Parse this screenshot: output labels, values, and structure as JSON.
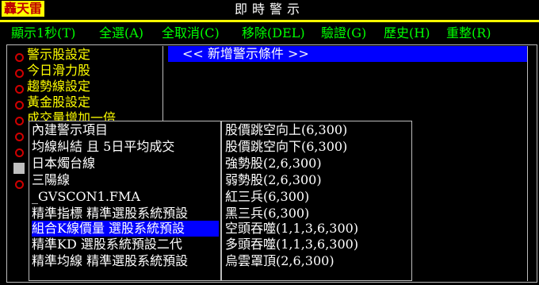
{
  "logo": "轟天雷",
  "title": "即時警示",
  "menu": [
    "顯示1秒(T)",
    "全選(A)",
    "全取消(C)",
    "移除(DEL)",
    "驗證(G)",
    "歷史(H)",
    "重整(R)"
  ],
  "strategies": [
    "警示股設定",
    "今日滑力股",
    "趨勢線設定",
    "黃金股設定",
    "成交量增加一倍",
    "",
    "",
    "",
    ""
  ],
  "add_condition": "<< 新增警示條件 >>",
  "builtin_list": [
    "內建警示項目",
    "均線糾結 且 5日平均成交",
    "日本燭台線",
    "三陽線",
    "_GVSCON1.FMA",
    "精準指標 精準選股系統預設",
    "組合K線價量 選股系統預設",
    "精準KD 選股系統預設二代",
    "精準均線 精準選股系統預設"
  ],
  "selected_builtin_index": 6,
  "patterns": [
    "股價跳空向上(6,300)",
    "股價跳空向下(6,300)",
    "強勢股(2,6,300)",
    "弱勢股(2,6,300)",
    "紅三兵(6,300)",
    "黑三兵(6,300)",
    "空頭吞噬(1,1,3,6,300)",
    "多頭吞噬(1,1,3,6,300)",
    "烏雲罩頂(2,6,300)"
  ],
  "colors": {
    "background": "#000000",
    "menu_text": "#00ff00",
    "strategy_text": "#ffff00",
    "radio": "#d00000",
    "highlight": "#0000ff",
    "logo_bg": "#ffff00",
    "logo_text": "#c00000"
  }
}
